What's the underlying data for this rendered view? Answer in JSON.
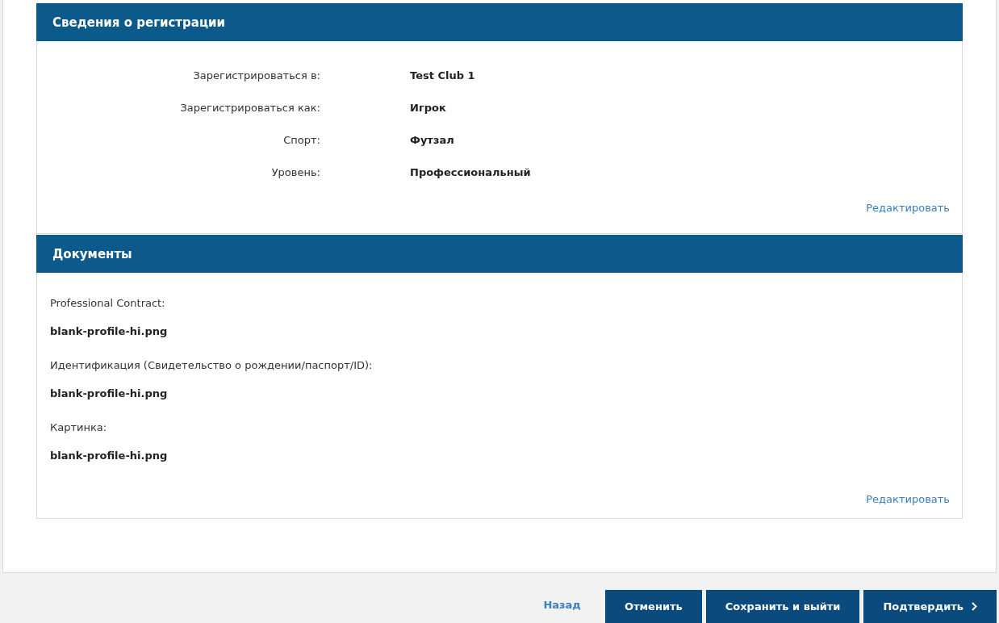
{
  "sections": [
    {
      "title": "Сведения о регистрации",
      "kind": "pairs",
      "rows": [
        {
          "label": "Зарегистрироваться в:",
          "value": "Test Club 1"
        },
        {
          "label": "Зарегистрироваться как:",
          "value": "Игрок"
        },
        {
          "label": "Спорт:",
          "value": "Футзал"
        },
        {
          "label": "Уровень:",
          "value": "Профессиональный"
        }
      ],
      "edit": "Редактировать"
    },
    {
      "title": "Документы",
      "kind": "documents",
      "rows": [
        {
          "label": "Professional Contract:",
          "value": "blank-profile-hi.png"
        },
        {
          "label": "Идентификация (Свидетельство о рождении/паспорт/ID):",
          "value": "blank-profile-hi.png"
        },
        {
          "label": "Картинка:",
          "value": "blank-profile-hi.png"
        }
      ],
      "edit": "Редактировать"
    }
  ],
  "footer": {
    "back": "Назад",
    "buttons": [
      {
        "label": "Отменить",
        "kind": "plain"
      },
      {
        "label": "Сохранить и выйти",
        "kind": "plain"
      },
      {
        "label": "Подтвердить",
        "kind": "next"
      }
    ]
  }
}
